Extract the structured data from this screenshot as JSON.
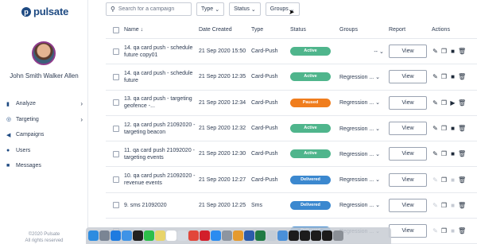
{
  "brand": {
    "name": "pulsate",
    "mark": "p"
  },
  "user": {
    "name": "John Smith Walker Allen"
  },
  "nav": [
    {
      "label": "Analyze",
      "icon": "bar-chart-icon",
      "glyph": "▮",
      "has_children": true
    },
    {
      "label": "Targeting",
      "icon": "target-icon",
      "glyph": "◎",
      "has_children": true
    },
    {
      "label": "Campaigns",
      "icon": "megaphone-icon",
      "glyph": "◀",
      "has_children": false
    },
    {
      "label": "Users",
      "icon": "users-icon",
      "glyph": "●",
      "has_children": false
    },
    {
      "label": "Messages",
      "icon": "chat-icon",
      "glyph": "■",
      "has_children": false
    }
  ],
  "footer": {
    "line1": "©2020 Pulsate",
    "line2": "All rights reserved"
  },
  "toolbar": {
    "search_placeholder": "Search for a campaign",
    "filters": [
      "Type",
      "Status",
      "Groups"
    ]
  },
  "table": {
    "headers": {
      "name": "Name",
      "date": "Date Created",
      "type": "Type",
      "status": "Status",
      "groups": "Groups",
      "report": "Report",
      "actions": "Actions"
    },
    "view_label": "View",
    "rows": [
      {
        "name": "14. qa card push - schedule future copy01",
        "date": "21 Sep 2020 15:50",
        "type": "Card-Push",
        "status": "Active",
        "groups": "--",
        "actions": [
          "edit",
          "copy",
          "stop",
          "delete"
        ]
      },
      {
        "name": "14. qa card push - schedule future",
        "date": "21 Sep 2020 12:35",
        "type": "Card-Push",
        "status": "Active",
        "groups": "Regression ...",
        "actions": [
          "edit",
          "copy",
          "stop",
          "delete"
        ]
      },
      {
        "name": "13. qa card push - targeting geofence -...",
        "date": "21 Sep 2020 12:34",
        "type": "Card-Push",
        "status": "Paused",
        "groups": "Regression ...",
        "actions": [
          "edit",
          "copy",
          "play",
          "delete"
        ]
      },
      {
        "name": "12. qa card push 21092020 - targeting beacon",
        "date": "21 Sep 2020 12:32",
        "type": "Card-Push",
        "status": "Active",
        "groups": "Regression ...",
        "actions": [
          "edit",
          "copy",
          "stop",
          "delete"
        ]
      },
      {
        "name": "11. qa card push 21092020 - targeting events",
        "date": "21 Sep 2020 12:30",
        "type": "Card-Push",
        "status": "Active",
        "groups": "Regression ...",
        "actions": [
          "edit",
          "copy",
          "stop",
          "delete"
        ]
      },
      {
        "name": "10. qa card push 21092020 - revenue events",
        "date": "21 Sep 2020 12:27",
        "type": "Card-Push",
        "status": "Delivered",
        "groups": "Regression ...",
        "actions": [
          "edit-disabled",
          "copy",
          "stop-disabled",
          "delete"
        ]
      },
      {
        "name": "9. sms 21092020",
        "date": "21 Sep 2020 12:25",
        "type": "Sms",
        "status": "Delivered",
        "groups": "Regression ...",
        "actions": [
          "edit-disabled",
          "copy",
          "stop-disabled",
          "delete"
        ]
      },
      {
        "name": "",
        "date": "",
        "type": "",
        "status": "Delivered",
        "groups": "Regression ...",
        "actions": [
          "edit-disabled",
          "copy",
          "stop-disabled",
          "delete"
        ]
      }
    ]
  },
  "status_colors": {
    "Active": "#4fb58c",
    "Paused": "#f07d1d",
    "Delivered": "#3b88cf"
  },
  "dock_icons": [
    {
      "name": "finder-icon",
      "color": "#2d8ce0"
    },
    {
      "name": "launchpad-icon",
      "color": "#7a8594"
    },
    {
      "name": "safari-icon",
      "color": "#1e7be0"
    },
    {
      "name": "mail-icon",
      "color": "#3f93e6"
    },
    {
      "name": "terminal-icon",
      "color": "#222222"
    },
    {
      "name": "facetime-icon",
      "color": "#2dbe4a"
    },
    {
      "name": "notes-icon",
      "color": "#e8d46a"
    },
    {
      "name": "calendar-icon",
      "color": "#ffffff"
    },
    {
      "name": "files-icon",
      "color": "#d6dbe2"
    },
    {
      "name": "chrome-icon",
      "color": "#e2463a"
    },
    {
      "name": "opera-icon",
      "color": "#d21f2b"
    },
    {
      "name": "appstore-icon",
      "color": "#2b8cf0"
    },
    {
      "name": "settings-icon",
      "color": "#8d95a0"
    },
    {
      "name": "photos-icon",
      "color": "#e59a2e"
    },
    {
      "name": "word-icon",
      "color": "#2b5cab"
    },
    {
      "name": "excel-icon",
      "color": "#1f7a43"
    },
    {
      "name": "preview-icon",
      "color": "#c3ccd6"
    },
    {
      "name": "folder-icon",
      "color": "#4a90d9"
    },
    {
      "name": "window-icon",
      "color": "#1c1c1c"
    },
    {
      "name": "window-icon",
      "color": "#1c1c1c"
    },
    {
      "name": "window-icon",
      "color": "#1c1c1c"
    },
    {
      "name": "window-icon",
      "color": "#1c1c1c"
    },
    {
      "name": "trash-icon",
      "color": "#8a8f96"
    }
  ]
}
